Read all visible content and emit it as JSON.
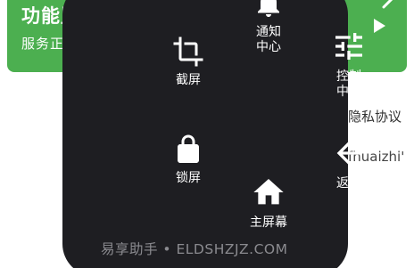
{
  "background": {
    "card_title": "功能监",
    "card_subtitle": "服务正",
    "privacy_text": "隐私协议",
    "pinyin_text": "fhuaizhi'",
    "card_color": "#4caf50",
    "icons": [
      "play-icon",
      "chevron-icon"
    ]
  },
  "menu": {
    "background_color": "#1e1e22",
    "items": [
      {
        "id": "notify",
        "label": "通知\n中心",
        "icon": "bell-icon"
      },
      {
        "id": "crop",
        "label": "截屏",
        "icon": "crop-icon"
      },
      {
        "id": "control",
        "label": "控制\n中心",
        "icon": "sliders-icon"
      },
      {
        "id": "lock",
        "label": "锁屏",
        "icon": "lock-icon"
      },
      {
        "id": "back",
        "label": "返回",
        "icon": "arrow-left-icon"
      },
      {
        "id": "home",
        "label": "主屏幕",
        "icon": "home-icon"
      }
    ]
  },
  "watermark": "易享助手 • ELDSHZJZ.COM"
}
